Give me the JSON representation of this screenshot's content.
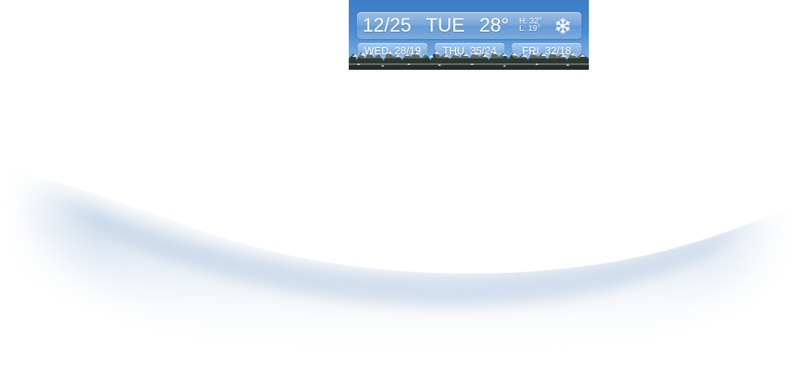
{
  "widget": {
    "today": {
      "date": "12/25",
      "day": "TUE",
      "temp": "28°",
      "high": "H: 32°",
      "low": "L: 19°",
      "icon": "snowflake-icon"
    },
    "forecast": [
      {
        "day": "WED",
        "temps": "28/19"
      },
      {
        "day": "THU",
        "temps": "35/24"
      },
      {
        "day": "FRI",
        "temps": "32/18"
      }
    ]
  },
  "colors": {
    "sky": "#4b8bd0",
    "shadow": "#9fbad8"
  }
}
